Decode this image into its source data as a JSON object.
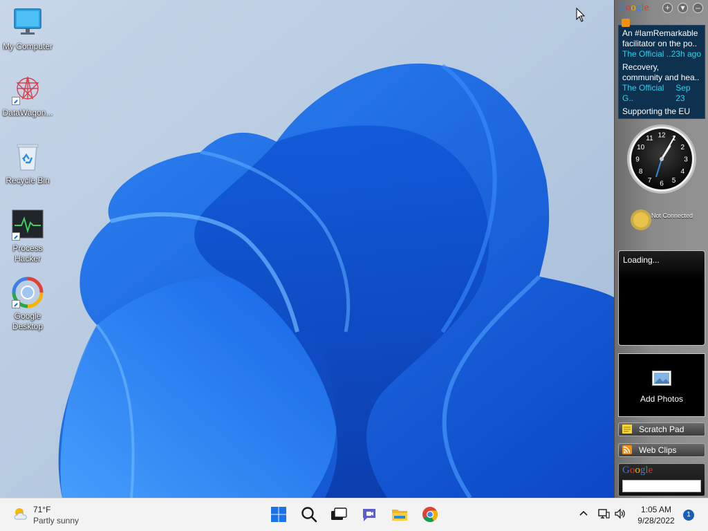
{
  "desktop": {
    "icons": [
      {
        "label": "My Computer",
        "icon": "monitor-icon"
      },
      {
        "label": "DataWagon...",
        "icon": "datawagon-icon"
      },
      {
        "label": "Recycle Bin",
        "icon": "recycle-bin-icon"
      },
      {
        "label": "Process Hacker",
        "icon": "process-hacker-icon"
      },
      {
        "label": "Google Desktop",
        "icon": "google-desktop-icon"
      }
    ]
  },
  "sidebar": {
    "logo": "Google",
    "news": [
      {
        "title": "An #IamRemarkable facilitator on the po..",
        "source": "The Official ..",
        "time": "23h ago"
      },
      {
        "title": "Recovery, community and hea..",
        "source": "The Official G..",
        "time": "Sep 23"
      },
      {
        "title": "Supporting the EU and securing the dig..",
        "source": "",
        "time": ""
      }
    ],
    "clock": {
      "numbers": [
        "12",
        "1",
        "2",
        "3",
        "4",
        "5",
        "6",
        "7",
        "8",
        "9",
        "10",
        "11"
      ],
      "hour": 1,
      "minute": 5
    },
    "weather_status": "Not Connected",
    "loading_text": "Loading...",
    "photos_label": "Add Photos",
    "scratch_pad_label": "Scratch Pad",
    "web_clips_label": "Web Clips",
    "search_logo": "Google",
    "search_value": ""
  },
  "taskbar": {
    "weather_temp": "71°F",
    "weather_condition": "Partly sunny",
    "apps": [
      "start-icon",
      "search-icon",
      "task-view-icon",
      "chat-icon",
      "file-explorer-icon",
      "chrome-icon"
    ],
    "time": "1:05 AM",
    "date": "9/28/2022",
    "notification_count": "1"
  },
  "colors": {
    "news_background": "#0f3150",
    "news_meta": "#23d7ef",
    "taskbar": "#f3f3f3",
    "wallpaper_blue": "#1565e0"
  }
}
